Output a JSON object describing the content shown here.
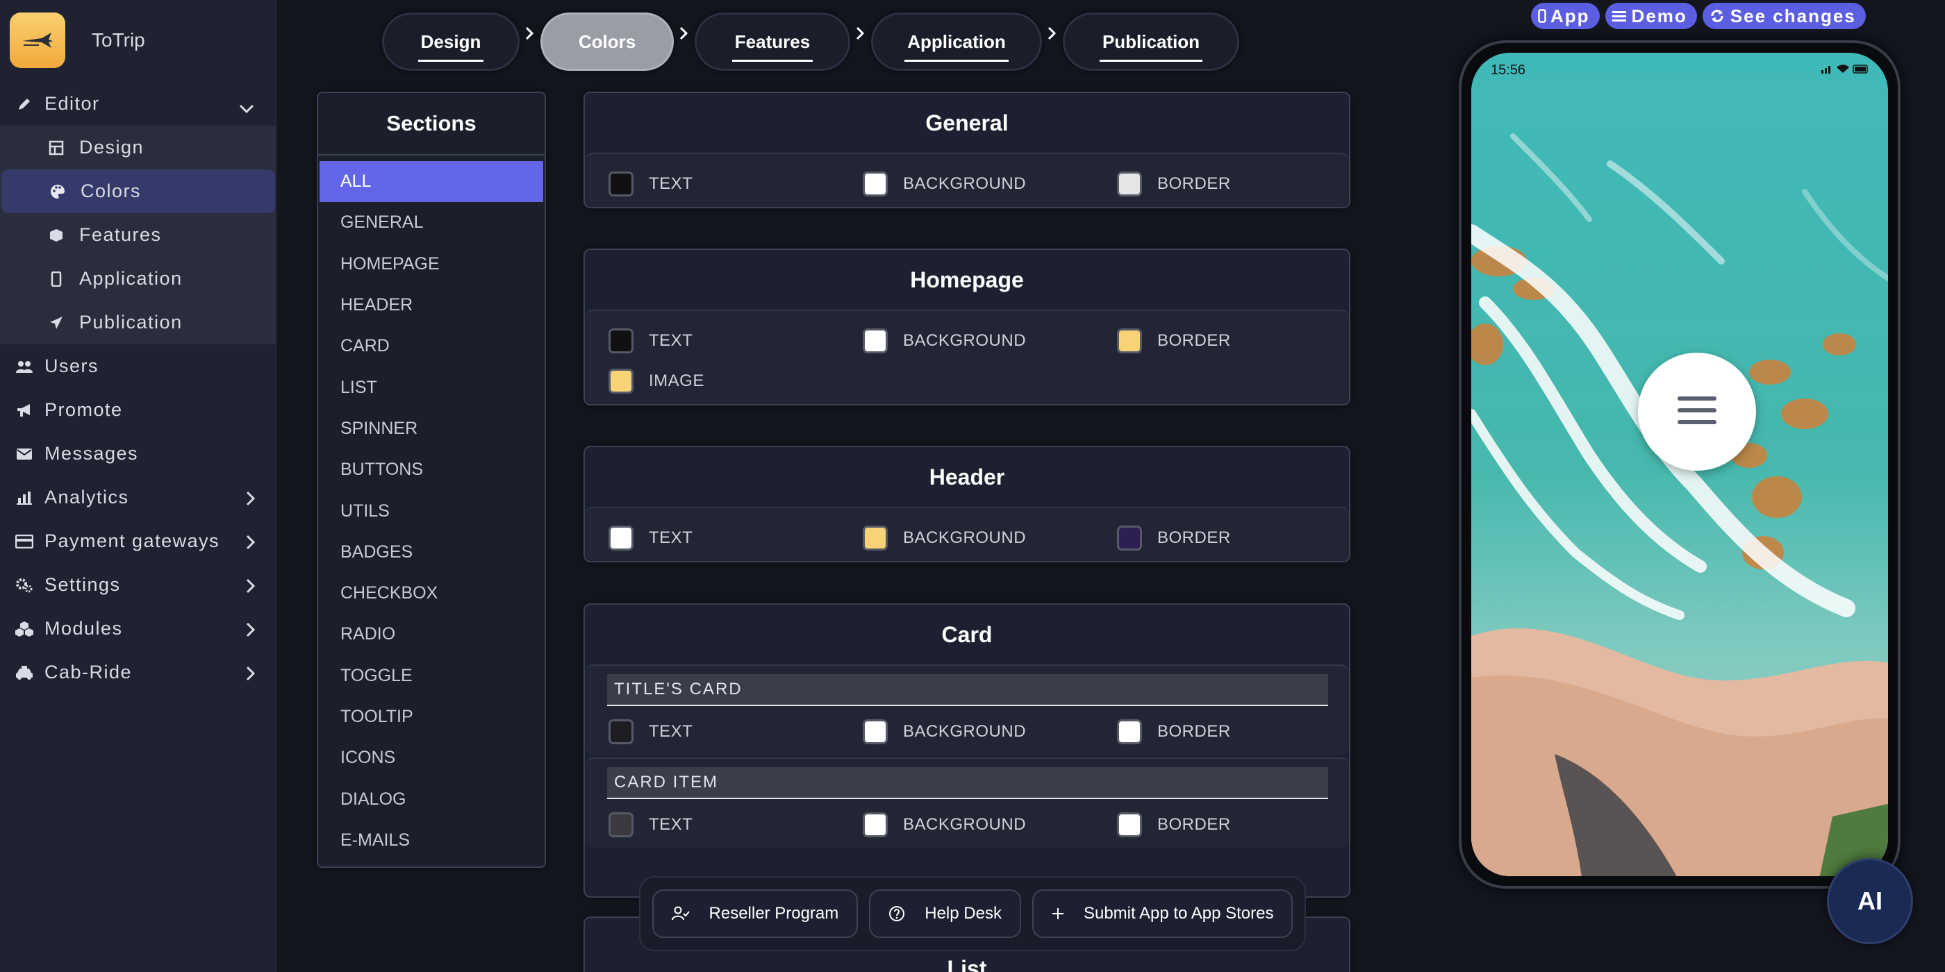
{
  "brand": {
    "name": "ToTrip"
  },
  "sidebar": {
    "editor": "Editor",
    "sub": [
      "Design",
      "Colors",
      "Features",
      "Application",
      "Publication"
    ],
    "items": [
      "Users",
      "Promote",
      "Messages",
      "Analytics",
      "Payment gateways",
      "Settings",
      "Modules",
      "Cab-Ride"
    ]
  },
  "steps": [
    "Design",
    "Colors",
    "Features",
    "Application",
    "Publication"
  ],
  "sections": {
    "title": "Sections",
    "items": [
      "ALL",
      "GENERAL",
      "HOMEPAGE",
      "HEADER",
      "CARD",
      "LIST",
      "SPINNER",
      "BUTTONS",
      "UTILS",
      "BADGES",
      "CHECKBOX",
      "RADIO",
      "TOGGLE",
      "TOOLTIP",
      "ICONS",
      "DIALOG",
      "E-MAILS"
    ]
  },
  "labels": {
    "text": "TEXT",
    "background": "BACKGROUND",
    "border": "BORDER",
    "image": "IMAGE"
  },
  "panels": {
    "general": {
      "title": "General",
      "colors": {
        "text": "#111111",
        "background": "#ffffff",
        "border": "#e6e6e6"
      }
    },
    "homepage": {
      "title": "Homepage",
      "colors": {
        "text": "#111111",
        "background": "#ffffff",
        "border": "#f8d277",
        "image": "#f8d277"
      }
    },
    "header": {
      "title": "Header",
      "colors": {
        "text": "#ffffff",
        "background": "#f8d277",
        "border": "#2c1f52"
      }
    },
    "card": {
      "title": "Card",
      "titles_card": "TITLE'S CARD",
      "card_item": "CARD ITEM",
      "colors": {
        "title_text": "#1e1e22",
        "title_background": "#ffffff",
        "title_border": "#ffffff",
        "item_text": "#3a3a3e",
        "item_background": "#ffffff",
        "item_border": "#ffffff"
      }
    },
    "list": {
      "title": "List"
    }
  },
  "phone": {
    "time": "15:56"
  },
  "top_pills": {
    "app": "App",
    "demo": "Demo",
    "see_changes": "See changes"
  },
  "bottom": {
    "reseller": "Reseller Program",
    "help": "Help Desk",
    "submit": "Submit App to App Stores"
  },
  "ai": "AI",
  "colors": {
    "accent": "#6366e8",
    "active_step": "#9b9da6"
  }
}
